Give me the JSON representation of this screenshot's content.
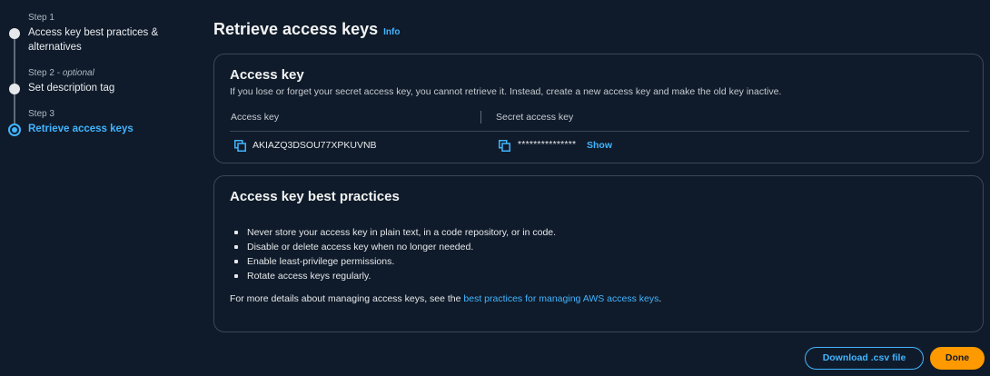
{
  "steps": [
    {
      "meta": "Step 1",
      "meta_suffix": "",
      "label": "Access key best practices & alternatives"
    },
    {
      "meta": "Step 2 - ",
      "meta_suffix": "optional",
      "label": "Set description tag"
    },
    {
      "meta": "Step 3",
      "meta_suffix": "",
      "label": "Retrieve access keys"
    }
  ],
  "page": {
    "title": "Retrieve access keys",
    "info": "Info"
  },
  "access_key_card": {
    "title": "Access key",
    "description": "If you lose or forget your secret access key, you cannot retrieve it. Instead, create a new access key and make the old key inactive.",
    "col_access_key": "Access key",
    "col_secret": "Secret access key",
    "access_key_value": "AKIAZQ3DSOU77XPKUVNB",
    "secret_masked": "***************",
    "show_label": "Show"
  },
  "best_practices_card": {
    "title": "Access key best practices",
    "items": [
      "Never store your access key in plain text, in a code repository, or in code.",
      "Disable or delete access key when no longer needed.",
      "Enable least-privilege permissions.",
      "Rotate access keys regularly."
    ],
    "more_prefix": "For more details about managing access keys, see the ",
    "more_link": "best practices for managing AWS access keys",
    "more_suffix": "."
  },
  "actions": {
    "download_label": "Download .csv file",
    "done_label": "Done"
  },
  "icons": {
    "copy": "copy-icon"
  },
  "colors": {
    "background": "#0f1b2a",
    "link": "#42b4ff",
    "primary": "#ff9900",
    "border": "#3b4656"
  }
}
